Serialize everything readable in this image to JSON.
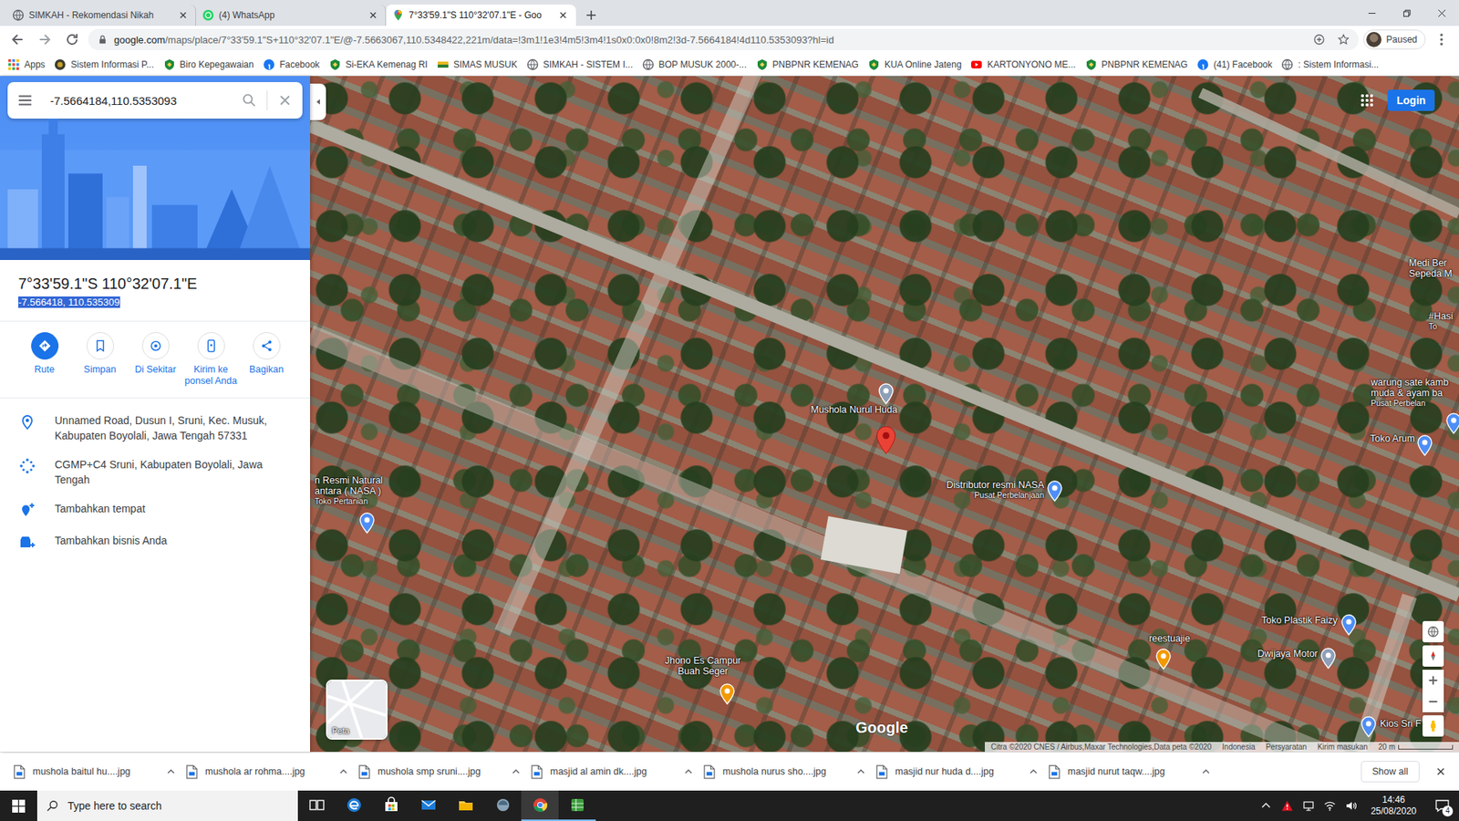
{
  "browser": {
    "tabs": [
      {
        "title": "SIMKAH - Rekomendasi Nikah",
        "kind": "globe",
        "selected": false
      },
      {
        "title": "(4) WhatsApp",
        "kind": "whatsapp",
        "selected": false
      },
      {
        "title": "7°33'59.1\"S 110°32'07.1\"E - Goo",
        "kind": "maps",
        "selected": true
      }
    ],
    "address": {
      "host": "google.com",
      "path": "/maps/place/7°33'59.1\"S+110°32'07.1\"E/@-7.5663067,110.5348422,221m/data=!3m1!1e3!4m5!3m4!1s0x0:0x0!8m2!3d-7.5664184!4d110.5353093?hl=id"
    },
    "profile": "Paused",
    "bookmarks": [
      {
        "label": "Apps",
        "kind": "apps"
      },
      {
        "label": "Sistem Informasi P...",
        "kind": "emblem"
      },
      {
        "label": "Biro Kepegawaian",
        "kind": "kemenag"
      },
      {
        "label": "Facebook",
        "kind": "facebook"
      },
      {
        "label": "Si-EKA Kemenag RI",
        "kind": "kemenag"
      },
      {
        "label": "SIMAS MUSUK",
        "kind": "simas"
      },
      {
        "label": "SIMKAH - SISTEM I...",
        "kind": "globe"
      },
      {
        "label": "BOP MUSUK 2000-...",
        "kind": "globe"
      },
      {
        "label": "PNBPNR KEMENAG",
        "kind": "kemenag"
      },
      {
        "label": "KUA Online Jateng",
        "kind": "kemenag"
      },
      {
        "label": "KARTONYONO ME...",
        "kind": "youtube"
      },
      {
        "label": "PNBPNR KEMENAG",
        "kind": "kemenag"
      },
      {
        "label": "(41) Facebook",
        "kind": "facebook"
      },
      {
        "label": ": Sistem Informasi...",
        "kind": "globe"
      }
    ]
  },
  "panel": {
    "search": "-7.5664184,110.5353093",
    "title": "7°33'59.1\"S 110°32'07.1\"E",
    "coordinates": {
      "text": "-7.566418, 110.535309",
      "selected": true
    },
    "actions": [
      {
        "label": "Rute",
        "kind": "route",
        "filled": true
      },
      {
        "label": "Simpan",
        "kind": "save",
        "filled": false
      },
      {
        "label": "Di Sekitar",
        "kind": "nearby",
        "filled": false
      },
      {
        "label": "Kirim ke ponsel Anda",
        "kind": "send",
        "filled": false
      },
      {
        "label": "Bagikan",
        "kind": "share",
        "filled": false
      }
    ],
    "info": [
      {
        "text": "Unnamed Road, Dusun I, Sruni, Kec. Musuk, Kabupaten Boyolali, Jawa Tengah 57331",
        "kind": "address"
      },
      {
        "text": "CGMP+C4 Sruni, Kabupaten Boyolali, Jawa Tengah",
        "kind": "pluscode"
      },
      {
        "text": "Tambahkan tempat",
        "kind": "add-place"
      },
      {
        "text": "Tambahkan bisnis Anda",
        "kind": "add-business"
      }
    ]
  },
  "map": {
    "login": "Login",
    "layer_thumbnail": "Peta",
    "logo": "Google",
    "places": [
      {
        "lines": [
          "Mushola Nurul Huda"
        ],
        "color": "#8da0b8"
      },
      {
        "lines": [
          "Distributor resmi NASA"
        ],
        "category": "Pusat Perbelanjaan",
        "color": "#4e8ef7"
      },
      {
        "lines": [
          "warung sate kamb",
          "muda & ayam ba"
        ],
        "category": "Pusat Perbelan",
        "color": "#4e8ef7"
      },
      {
        "lines": [
          "Medi Ber",
          "Sepeda M"
        ]
      },
      {
        "lines": [
          "#Hasi"
        ],
        "category": "To"
      },
      {
        "lines": [
          "Toko Arum"
        ],
        "color": "#4e8ef7"
      },
      {
        "lines": [
          "n Resmi Natural",
          "antara ( NASA )"
        ],
        "category": "Toko Pertanian",
        "color": "#4e8ef7"
      },
      {
        "lines": [
          "Toko Plastik Faizy"
        ],
        "color": "#4e8ef7"
      },
      {
        "lines": [
          "reestuajie"
        ],
        "color": "#f29900"
      },
      {
        "lines": [
          "Dwijaya Motor"
        ],
        "color": "#8da0b8"
      },
      {
        "lines": [
          "Jhono Es Campur",
          "Buah Seger"
        ],
        "color": "#f29900"
      },
      {
        "lines": [
          "Kios Sri F"
        ],
        "color": "#4e8ef7"
      }
    ],
    "attribution": [
      "Citra ©2020 CNES / Airbus,Maxar Technologies,Data peta ©2020",
      "Indonesia",
      "Persyaratan",
      "Kirim masukan"
    ],
    "scale": "20 m"
  },
  "downloads": {
    "items": [
      "mushola baitul hu....jpg",
      "mushola ar rohma....jpg",
      "mushola smp sruni....jpg",
      "masjid al amin dk....jpg",
      "mushola nurus sho....jpg",
      "masjid nur huda d....jpg",
      "masjid nurut taqw....jpg"
    ],
    "show_all": "Show all"
  },
  "taskbar": {
    "search_placeholder": "Type here to search",
    "apps": [
      {
        "kind": "task-view",
        "running": false,
        "selected": false
      },
      {
        "kind": "edge",
        "running": false,
        "selected": false
      },
      {
        "kind": "store",
        "running": false,
        "selected": false
      },
      {
        "kind": "mail",
        "running": false,
        "selected": false
      },
      {
        "kind": "explorer",
        "running": false,
        "selected": false
      },
      {
        "kind": "app",
        "running": false,
        "selected": false
      },
      {
        "kind": "chrome",
        "running": true,
        "selected": true
      },
      {
        "kind": "spreadsheet",
        "running": true,
        "selected": false
      }
    ],
    "time": "14:46",
    "date": "25/08/2020",
    "notifications": "4"
  }
}
